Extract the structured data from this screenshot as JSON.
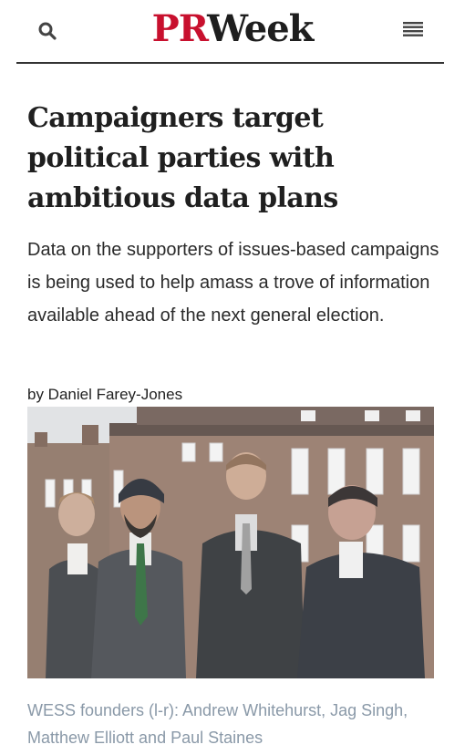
{
  "header": {
    "logo_pr": "PR",
    "logo_week": "Week",
    "search_icon": "search-icon",
    "menu_icon": "hamburger-menu-icon"
  },
  "article": {
    "headline": "Campaigners target political parties with ambitious data plans",
    "standfirst": "Data on the supporters of issues-based campaigns is being used to help amass a trove of information available ahead of the next general election.",
    "byline": "by Daniel Farey-Jones",
    "caption": "WESS founders (l-r): Andrew Whitehurst, Jag Singh, Matthew Elliott and Paul Staines"
  },
  "colors": {
    "brand_red": "#c8102e",
    "caption_grey": "#8a99a8"
  }
}
